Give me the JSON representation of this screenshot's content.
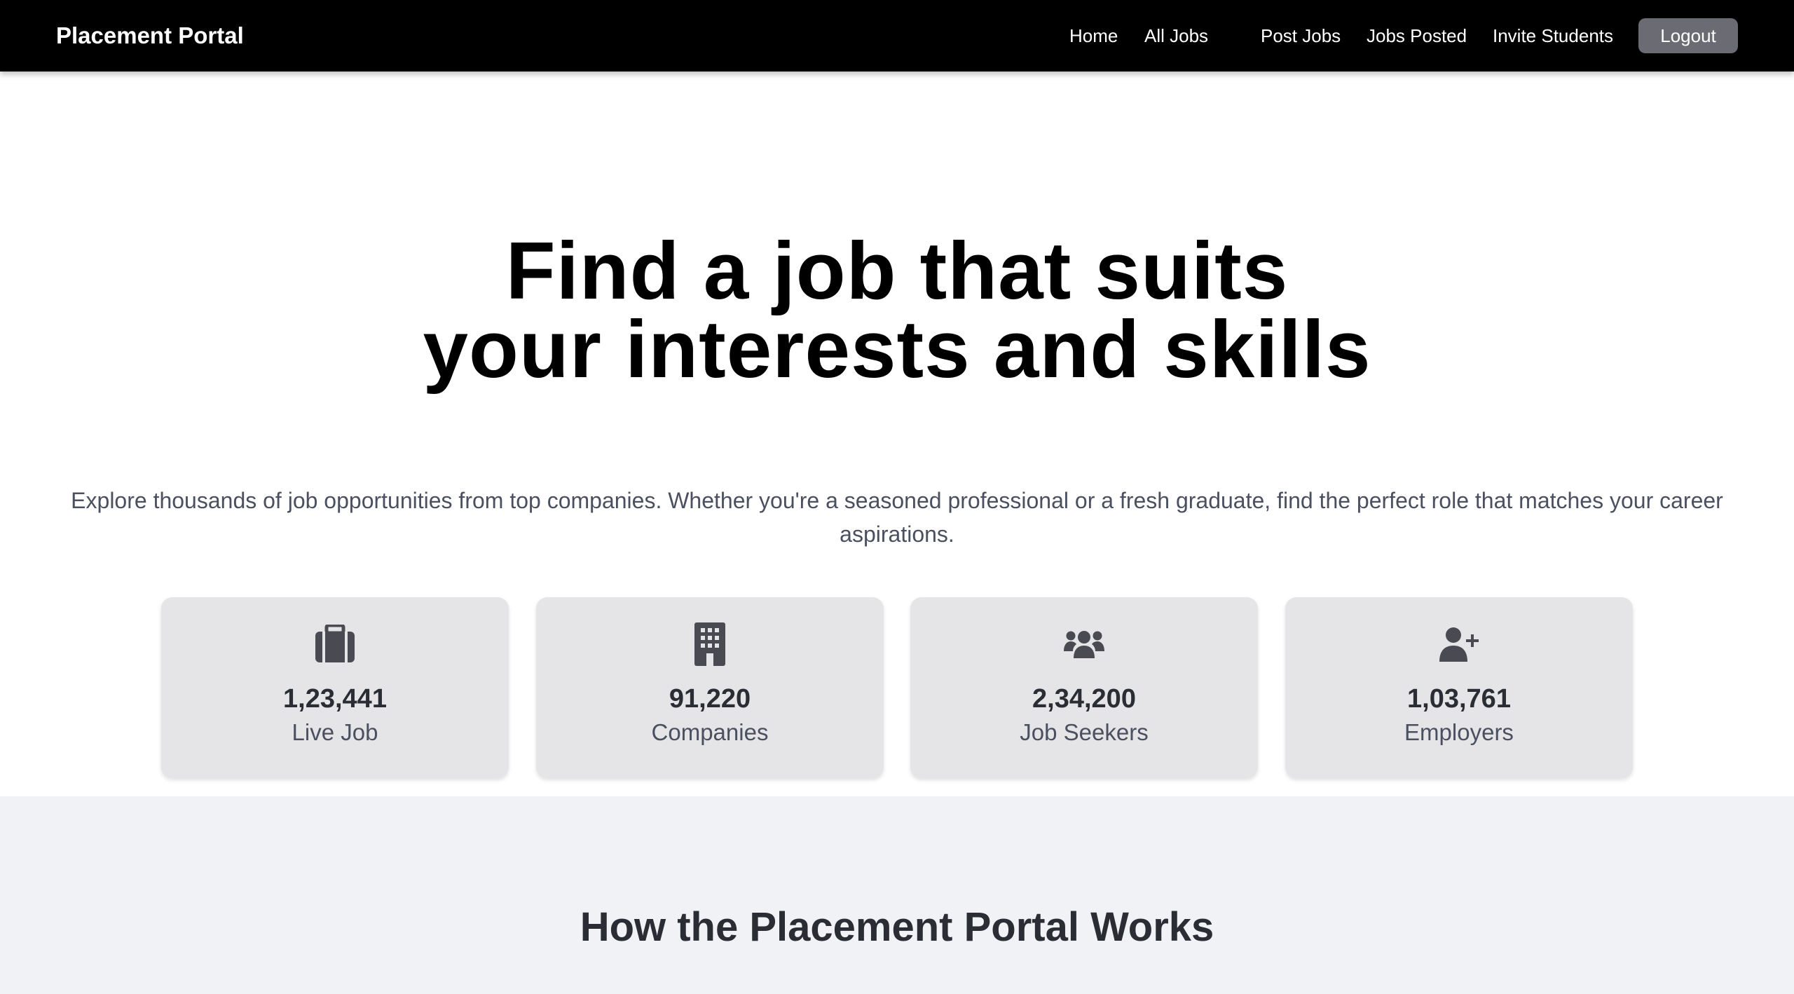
{
  "navbar": {
    "brand": "Placement Portal",
    "links": [
      "Home",
      "All Jobs",
      "Post Jobs",
      "Jobs Posted",
      "Invite Students"
    ],
    "logout_label": "Logout"
  },
  "hero": {
    "title_line1": "Find a job that suits",
    "title_line2": "your interests and skills",
    "subtitle": "Explore thousands of job opportunities from top companies. Whether you're a seasoned professional or a fresh graduate, find the perfect role that matches your career aspirations."
  },
  "stats": [
    {
      "icon": "briefcase-icon",
      "value": "1,23,441",
      "label": "Live Job"
    },
    {
      "icon": "building-icon",
      "value": "91,220",
      "label": "Companies"
    },
    {
      "icon": "users-icon",
      "value": "2,34,200",
      "label": "Job Seekers"
    },
    {
      "icon": "user-plus-icon",
      "value": "1,03,761",
      "label": "Employers"
    }
  ],
  "how_it_works": {
    "title": "How the Placement Portal Works"
  },
  "colors": {
    "navbar_bg": "#000000",
    "logout_bg": "#6b6b73",
    "card_bg": "#e5e5e8",
    "icon_color": "#4a4b52",
    "section_bg": "#f1f2f6"
  }
}
